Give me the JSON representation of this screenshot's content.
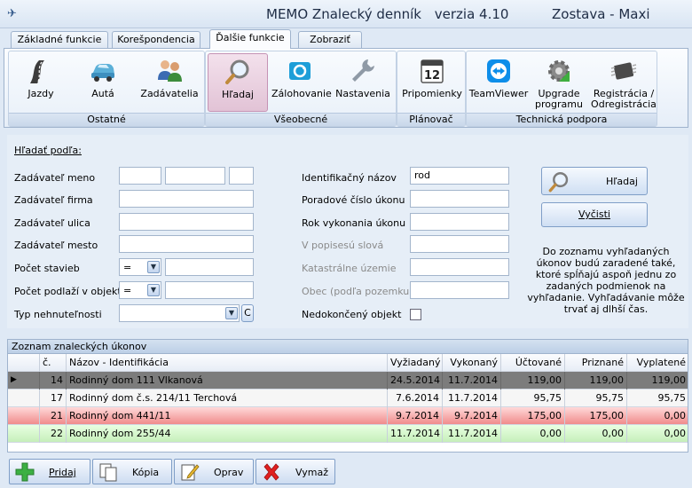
{
  "window": {
    "title_left": "MEMO  Znalecký denník",
    "version": "verzia 4.10",
    "title_right": "Zostava - Maxi",
    "icon": "app-logo-icon"
  },
  "tabs": [
    {
      "label": "Základné funkcie"
    },
    {
      "label": "Korešpondencia"
    },
    {
      "label": "Ďalšie funkcie"
    },
    {
      "label": "Zobraziť"
    }
  ],
  "ribbon": {
    "groups": [
      {
        "label": "Ostatné",
        "buttons": [
          {
            "label": "Jazdy",
            "icon": "road-icon"
          },
          {
            "label": "Autá",
            "icon": "car-icon"
          },
          {
            "label": "Zadávatelia",
            "icon": "users-icon"
          }
        ]
      },
      {
        "label": "Všeobecné",
        "buttons": [
          {
            "label": "Hľadaj",
            "icon": "magnifier-icon"
          },
          {
            "label": "Zálohovanie",
            "icon": "backup-icon"
          },
          {
            "label": "Nastavenia",
            "icon": "wrench-icon"
          }
        ]
      },
      {
        "label": "Plánovač",
        "buttons": [
          {
            "label": "Pripomienky",
            "icon": "calendar-icon",
            "day": "12"
          }
        ]
      },
      {
        "label": "Technická podpora",
        "buttons": [
          {
            "label": "TeamViewer",
            "icon": "teamviewer-icon"
          },
          {
            "label": "Upgrade programu",
            "icon": "upgrade-gear-icon"
          },
          {
            "label": "Registrácia / Odregistrácia",
            "icon": "chip-icon"
          }
        ]
      }
    ]
  },
  "search": {
    "heading": "Hľadať podľa:",
    "left": {
      "zad_meno": "Zadávateľ meno",
      "zad_firma": "Zadávateľ firma",
      "zad_ulica": "Zadávateľ ulica",
      "zad_mesto": "Zadávateľ mesto",
      "pocet_stavieb": "Počet stavieb",
      "pocet_podlazi": "Počet podlaží v objekte",
      "typ": "Typ nehnuteľnosti",
      "op_stavieb": "=",
      "op_podlazi": "=",
      "c_button": "C"
    },
    "right": {
      "ident": "Identifikačný názov",
      "ident_value": "rod",
      "poradove": "Poradové číslo úkonu",
      "rok": "Rok vykonania úkonu",
      "popis": "V popisesú slová",
      "kataster": "Katastrálne územie",
      "obec": "Obec (podľa pozemku)",
      "nedokonceny": "Nedokončený objekt"
    },
    "btn_search": "Hľadaj",
    "btn_clear": "Vyčisti",
    "hint": "Do zoznamu vyhľadaných úkonov budú zaradené také, ktoré spĺňajú aspoň jednu zo zadaných podmienok na vyhľadanie. Vyhľadávanie môže trvať aj dlhší čas."
  },
  "grid": {
    "title": "Zoznam znaleckých úkonov",
    "columns": [
      "č.",
      "Názov - Identifikácia",
      "Vyžiadaný",
      "Vykonaný",
      "Účtované",
      "Priznané",
      "Vyplatené"
    ],
    "rows": [
      {
        "marker": "▶",
        "c": "14",
        "nazov": "Rodinný dom 111 Vlkanová",
        "vyziadany": "24.5.2014",
        "vykonany": "11.7.2014",
        "uctovane": "119,00",
        "priznane": "119,00",
        "vyplatene": "119,00"
      },
      {
        "marker": "",
        "c": "17",
        "nazov": "Rodinný dom č.s. 214/11 Terchová",
        "vyziadany": "7.6.2014",
        "vykonany": "11.7.2014",
        "uctovane": "95,75",
        "priznane": "95,75",
        "vyplatene": "95,75"
      },
      {
        "marker": "",
        "c": "21",
        "nazov": "Rodinný dom 441/11",
        "vyziadany": "9.7.2014",
        "vykonany": "9.7.2014",
        "uctovane": "175,00",
        "priznane": "175,00",
        "vyplatene": "0,00"
      },
      {
        "marker": "",
        "c": "22",
        "nazov": "Rodinný dom 255/44",
        "vyziadany": "11.7.2014",
        "vykonany": "11.7.2014",
        "uctovane": "0,00",
        "priznane": "0,00",
        "vyplatene": "0,00"
      }
    ]
  },
  "bottom_buttons": [
    {
      "label": "Pridaj",
      "icon": "plus-icon"
    },
    {
      "label": "Kópia",
      "icon": "copy-icon"
    },
    {
      "label": "Oprav",
      "icon": "edit-icon"
    },
    {
      "label": "Vymaž",
      "icon": "delete-icon"
    }
  ],
  "colors": {
    "accent": "#7f9ec7",
    "selected_row": "#7c7c7c",
    "red_row": "#f08c8c",
    "green_row": "#c6efba"
  }
}
